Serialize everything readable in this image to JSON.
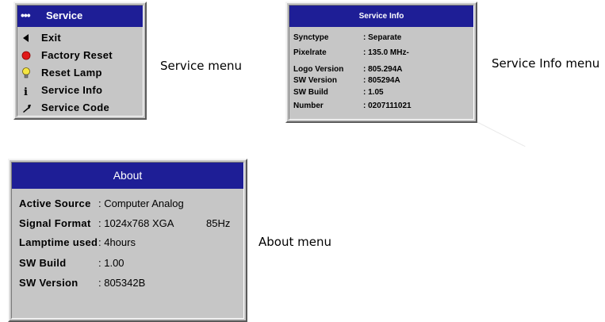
{
  "service_menu": {
    "dots": "•••",
    "title": "Service",
    "items": [
      {
        "icon": "left-arrow-icon",
        "label": "Exit"
      },
      {
        "icon": "red-circle-icon",
        "label": "Factory Reset"
      },
      {
        "icon": "lamp-bulb-icon",
        "label": "Reset Lamp"
      },
      {
        "icon": "info-icon",
        "label": "Service Info"
      },
      {
        "icon": "wrench-icon",
        "label": "Service Code"
      }
    ],
    "caption": "Service menu"
  },
  "service_info_menu": {
    "title": "Service Info",
    "rows": [
      {
        "key": "Synctype",
        "value": ": Separate"
      },
      {
        "key": "Pixelrate",
        "value": ": 135.0  MHz-"
      },
      {
        "key": "Logo Version",
        "value": ": 805.294A"
      },
      {
        "key": "SW Version",
        "value": ": 805294A"
      },
      {
        "key": "SW Build",
        "value": ": 1.05"
      },
      {
        "key": "Number",
        "value": ": 0207111021"
      }
    ],
    "caption": "Service Info menu"
  },
  "about_menu": {
    "title": "About",
    "rows": [
      {
        "key": "Active Source",
        "value": ": Computer Analog",
        "extra": ""
      },
      {
        "key": "Signal Format",
        "value": ": 1024x768 XGA",
        "extra": "85Hz"
      },
      {
        "key": "Lamptime used",
        "value": ": 4hours",
        "extra": ""
      },
      {
        "key": "SW Build",
        "value": ": 1.00",
        "extra": ""
      },
      {
        "key": "SW Version",
        "value": ": 805342B",
        "extra": ""
      }
    ],
    "caption": "About menu"
  },
  "colors": {
    "titlebar": "#1e1e96",
    "panel": "#c6c6c6",
    "title_text": "#ffffff"
  }
}
